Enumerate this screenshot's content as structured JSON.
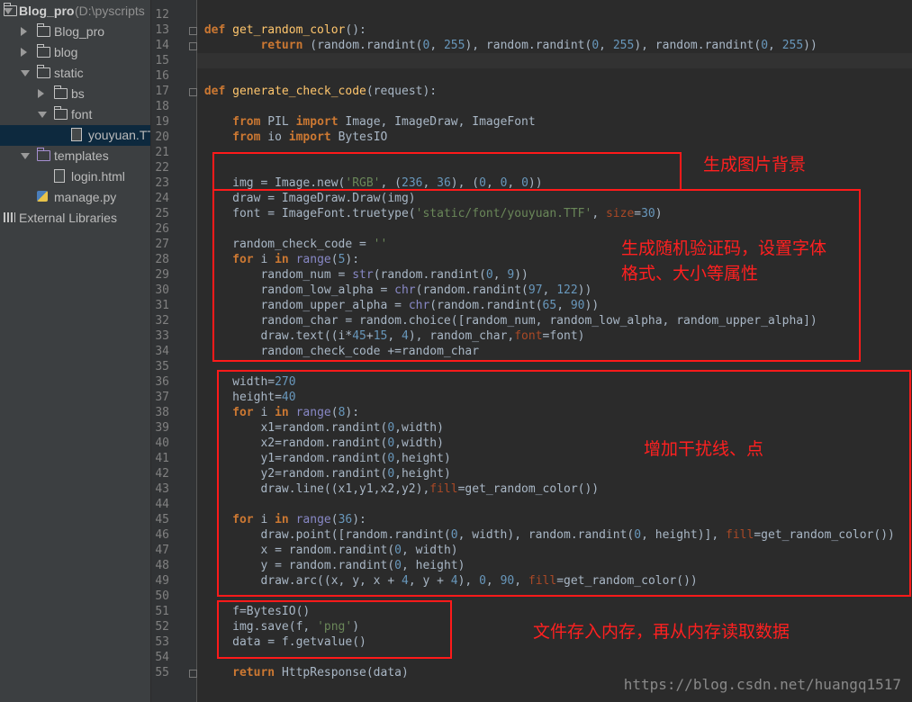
{
  "project_tree": [
    {
      "label": "Blog_pro",
      "suffix": " (D:\\pyscripts",
      "icon": "folder-icon",
      "expanded": true,
      "depth": 0,
      "bold": true
    },
    {
      "label": "Blog_pro",
      "icon": "folder-icon",
      "expanded": false,
      "depth": 1
    },
    {
      "label": "blog",
      "icon": "folder-icon",
      "expanded": false,
      "depth": 1
    },
    {
      "label": "static",
      "icon": "folder-icon",
      "expanded": true,
      "depth": 1
    },
    {
      "label": "bs",
      "icon": "folder-icon",
      "expanded": false,
      "depth": 2
    },
    {
      "label": "font",
      "icon": "folder-icon",
      "expanded": true,
      "depth": 2
    },
    {
      "label": "youyuan.TTF",
      "icon": "file-icon",
      "depth": 3,
      "selected": true
    },
    {
      "label": "templates",
      "icon": "template-folder-icon",
      "expanded": true,
      "depth": 1
    },
    {
      "label": "login.html",
      "icon": "html-file-icon",
      "depth": 2
    },
    {
      "label": "manage.py",
      "icon": "python-file-icon",
      "depth": 1
    },
    {
      "label": "External Libraries",
      "icon": "library-icon",
      "depth": 0
    }
  ],
  "code_lines": [
    {
      "n": "12",
      "t": [
        [
          "",
          ""
        ]
      ]
    },
    {
      "n": "13",
      "t": [
        [
          "k",
          "def "
        ],
        [
          "fn",
          "get_random_color"
        ],
        [
          "",
          "():"
        ]
      ]
    },
    {
      "n": "14",
      "t": [
        [
          "",
          "        "
        ],
        [
          "k",
          "return "
        ],
        [
          "",
          "(random.randint("
        ],
        [
          "num",
          "0"
        ],
        [
          "",
          ", "
        ],
        [
          "num",
          "255"
        ],
        [
          "",
          "), random.randint("
        ],
        [
          "num",
          "0"
        ],
        [
          "",
          ", "
        ],
        [
          "num",
          "255"
        ],
        [
          "",
          "), random.randint("
        ],
        [
          "num",
          "0"
        ],
        [
          "",
          ", "
        ],
        [
          "num",
          "255"
        ],
        [
          "",
          "))"
        ]
      ]
    },
    {
      "n": "15",
      "t": [
        [
          "",
          ""
        ]
      ],
      "current": true
    },
    {
      "n": "16",
      "t": [
        [
          "",
          ""
        ]
      ]
    },
    {
      "n": "17",
      "t": [
        [
          "k",
          "def "
        ],
        [
          "fn",
          "generate_check_code"
        ],
        [
          "",
          "(request):"
        ]
      ]
    },
    {
      "n": "18",
      "t": [
        [
          "",
          ""
        ]
      ]
    },
    {
      "n": "19",
      "t": [
        [
          "",
          "    "
        ],
        [
          "k",
          "from "
        ],
        [
          "",
          "PIL "
        ],
        [
          "k",
          "import "
        ],
        [
          "",
          "Image, ImageDraw, ImageFont"
        ]
      ]
    },
    {
      "n": "20",
      "t": [
        [
          "",
          "    "
        ],
        [
          "k",
          "from "
        ],
        [
          "",
          "io "
        ],
        [
          "k",
          "import "
        ],
        [
          "",
          "BytesIO"
        ]
      ]
    },
    {
      "n": "21",
      "t": [
        [
          "",
          ""
        ]
      ]
    },
    {
      "n": "22",
      "t": [
        [
          "",
          ""
        ]
      ]
    },
    {
      "n": "23",
      "t": [
        [
          "",
          "    img = Image.new("
        ],
        [
          "str",
          "'RGB'"
        ],
        [
          "",
          ", ("
        ],
        [
          "num",
          "236"
        ],
        [
          "",
          ", "
        ],
        [
          "num",
          "36"
        ],
        [
          "",
          "), ("
        ],
        [
          "num",
          "0"
        ],
        [
          "",
          ", "
        ],
        [
          "num",
          "0"
        ],
        [
          "",
          ", "
        ],
        [
          "num",
          "0"
        ],
        [
          "",
          "))"
        ]
      ]
    },
    {
      "n": "24",
      "t": [
        [
          "",
          "    draw = ImageDraw.Draw(img)"
        ]
      ]
    },
    {
      "n": "25",
      "t": [
        [
          "",
          "    font = ImageFont.truetype("
        ],
        [
          "str",
          "'static/font/youyuan.TTF'"
        ],
        [
          "",
          ", "
        ],
        [
          "kw",
          "size"
        ],
        [
          "",
          "="
        ],
        [
          "num",
          "30"
        ],
        [
          "",
          ")"
        ]
      ]
    },
    {
      "n": "26",
      "t": [
        [
          "",
          ""
        ]
      ]
    },
    {
      "n": "27",
      "t": [
        [
          "",
          "    random_check_code = "
        ],
        [
          "str",
          "''"
        ]
      ]
    },
    {
      "n": "28",
      "t": [
        [
          "",
          "    "
        ],
        [
          "k",
          "for "
        ],
        [
          "",
          "i "
        ],
        [
          "k",
          "in "
        ],
        [
          "bi",
          "range"
        ],
        [
          "",
          "("
        ],
        [
          "num",
          "5"
        ],
        [
          "",
          "):"
        ]
      ]
    },
    {
      "n": "29",
      "t": [
        [
          "",
          "        random_num = "
        ],
        [
          "bi",
          "str"
        ],
        [
          "",
          "(random.randint("
        ],
        [
          "num",
          "0"
        ],
        [
          "",
          ", "
        ],
        [
          "num",
          "9"
        ],
        [
          "",
          "))"
        ]
      ]
    },
    {
      "n": "30",
      "t": [
        [
          "",
          "        random_low_alpha = "
        ],
        [
          "bi",
          "chr"
        ],
        [
          "",
          "(random.randint("
        ],
        [
          "num",
          "97"
        ],
        [
          "",
          ", "
        ],
        [
          "num",
          "122"
        ],
        [
          "",
          "))"
        ]
      ]
    },
    {
      "n": "31",
      "t": [
        [
          "",
          "        random_upper_alpha = "
        ],
        [
          "bi",
          "chr"
        ],
        [
          "",
          "(random.randint("
        ],
        [
          "num",
          "65"
        ],
        [
          "",
          ", "
        ],
        [
          "num",
          "90"
        ],
        [
          "",
          "))"
        ]
      ]
    },
    {
      "n": "32",
      "t": [
        [
          "",
          "        random_char = random.choice([random_num, random_low_alpha, random_upper_alpha])"
        ]
      ]
    },
    {
      "n": "33",
      "t": [
        [
          "",
          "        draw.text((i*"
        ],
        [
          "num",
          "45"
        ],
        [
          "",
          "+"
        ],
        [
          "num",
          "15"
        ],
        [
          "",
          ", "
        ],
        [
          "num",
          "4"
        ],
        [
          "",
          "), random_char,"
        ],
        [
          "kw",
          "font"
        ],
        [
          "",
          "=font)"
        ]
      ]
    },
    {
      "n": "34",
      "t": [
        [
          "",
          "        random_check_code +=random_char"
        ]
      ]
    },
    {
      "n": "35",
      "t": [
        [
          "",
          ""
        ]
      ]
    },
    {
      "n": "36",
      "t": [
        [
          "",
          "    width="
        ],
        [
          "num",
          "270"
        ]
      ]
    },
    {
      "n": "37",
      "t": [
        [
          "",
          "    height="
        ],
        [
          "num",
          "40"
        ]
      ]
    },
    {
      "n": "38",
      "t": [
        [
          "",
          "    "
        ],
        [
          "k",
          "for "
        ],
        [
          "",
          "i "
        ],
        [
          "k",
          "in "
        ],
        [
          "bi",
          "range"
        ],
        [
          "",
          "("
        ],
        [
          "num",
          "8"
        ],
        [
          "",
          "):"
        ]
      ]
    },
    {
      "n": "39",
      "t": [
        [
          "",
          "        x1=random.randint("
        ],
        [
          "num",
          "0"
        ],
        [
          "",
          ",width)"
        ]
      ]
    },
    {
      "n": "40",
      "t": [
        [
          "",
          "        x2=random.randint("
        ],
        [
          "num",
          "0"
        ],
        [
          "",
          ",width)"
        ]
      ]
    },
    {
      "n": "41",
      "t": [
        [
          "",
          "        y1=random.randint("
        ],
        [
          "num",
          "0"
        ],
        [
          "",
          ",height)"
        ]
      ]
    },
    {
      "n": "42",
      "t": [
        [
          "",
          "        y2=random.randint("
        ],
        [
          "num",
          "0"
        ],
        [
          "",
          ",height)"
        ]
      ]
    },
    {
      "n": "43",
      "t": [
        [
          "",
          "        draw.line((x1,y1,x2,y2),"
        ],
        [
          "kw",
          "fill"
        ],
        [
          "",
          "=get_random_color())"
        ]
      ]
    },
    {
      "n": "44",
      "t": [
        [
          "",
          ""
        ]
      ]
    },
    {
      "n": "45",
      "t": [
        [
          "",
          "    "
        ],
        [
          "k",
          "for "
        ],
        [
          "",
          "i "
        ],
        [
          "k",
          "in "
        ],
        [
          "bi",
          "range"
        ],
        [
          "",
          "("
        ],
        [
          "num",
          "36"
        ],
        [
          "",
          "):"
        ]
      ]
    },
    {
      "n": "46",
      "t": [
        [
          "",
          "        draw.point([random.randint("
        ],
        [
          "num",
          "0"
        ],
        [
          "",
          ", width), random.randint("
        ],
        [
          "num",
          "0"
        ],
        [
          "",
          ", height)], "
        ],
        [
          "kw",
          "fill"
        ],
        [
          "",
          "=get_random_color())"
        ]
      ]
    },
    {
      "n": "47",
      "t": [
        [
          "",
          "        x = random.randint("
        ],
        [
          "num",
          "0"
        ],
        [
          "",
          ", width)"
        ]
      ]
    },
    {
      "n": "48",
      "t": [
        [
          "",
          "        y = random.randint("
        ],
        [
          "num",
          "0"
        ],
        [
          "",
          ", height)"
        ]
      ]
    },
    {
      "n": "49",
      "t": [
        [
          "",
          "        draw.arc((x, y, x + "
        ],
        [
          "num",
          "4"
        ],
        [
          "",
          ", y + "
        ],
        [
          "num",
          "4"
        ],
        [
          "",
          "), "
        ],
        [
          "num",
          "0"
        ],
        [
          "",
          ", "
        ],
        [
          "num",
          "90"
        ],
        [
          "",
          ", "
        ],
        [
          "kw",
          "fill"
        ],
        [
          "",
          "=get_random_color())"
        ]
      ]
    },
    {
      "n": "50",
      "t": [
        [
          "",
          ""
        ]
      ]
    },
    {
      "n": "51",
      "t": [
        [
          "",
          "    f=BytesIO()"
        ]
      ]
    },
    {
      "n": "52",
      "t": [
        [
          "",
          "    img.save(f, "
        ],
        [
          "str",
          "'png'"
        ],
        [
          "",
          ")"
        ]
      ]
    },
    {
      "n": "53",
      "t": [
        [
          "",
          "    data = f.getvalue()"
        ]
      ]
    },
    {
      "n": "54",
      "t": [
        [
          "",
          ""
        ]
      ]
    },
    {
      "n": "55",
      "t": [
        [
          "",
          "    "
        ],
        [
          "k",
          "return "
        ],
        [
          "",
          "HttpResponse(data)"
        ]
      ]
    }
  ],
  "annotations": [
    {
      "text": "生成图片背景"
    },
    {
      "text": "生成随机验证码，设置字体\n格式、大小等属性"
    },
    {
      "text": "增加干扰线、点"
    },
    {
      "text": "文件存入内存，再从内存读取数据"
    }
  ],
  "watermark": "https://blog.csdn.net/huangq1517",
  "colors": {
    "annotation": "#ff1a1a",
    "background": "#2b2b2b",
    "keyword": "#cc7832",
    "function": "#ffc66d",
    "number": "#6897bb",
    "string": "#6a8759"
  }
}
